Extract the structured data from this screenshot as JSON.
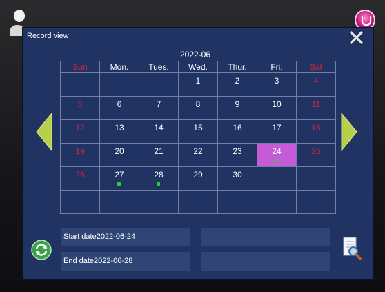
{
  "window": {
    "title": "Record view"
  },
  "calendar": {
    "month": "2022-06",
    "weekdays": [
      "Sun",
      "Mon.",
      "Tues.",
      "Wed.",
      "Thur.",
      "Fri.",
      "Sat"
    ],
    "weeks": [
      [
        "",
        "",
        "",
        "1",
        "2",
        "3",
        "4"
      ],
      [
        "5",
        "6",
        "7",
        "8",
        "9",
        "10",
        "11"
      ],
      [
        "12",
        "13",
        "14",
        "15",
        "16",
        "17",
        "18"
      ],
      [
        "19",
        "20",
        "21",
        "22",
        "23",
        "24",
        "25"
      ],
      [
        "26",
        "27",
        "28",
        "29",
        "30",
        "",
        ""
      ],
      [
        "",
        "",
        "",
        "",
        "",
        "",
        ""
      ]
    ],
    "selected_day": "24",
    "record_days": [
      "24",
      "27",
      "28"
    ],
    "colors": {
      "weekend": "#d9243a",
      "selected": "#c55bd6",
      "record_dot": "#2bd12b"
    }
  },
  "filters": {
    "start_date": "Start date2022-06-24",
    "end_date": "End date2022-06-28"
  },
  "icons": {
    "user": "user-icon",
    "top_right": "app-badge-icon",
    "close": "close-icon",
    "prev": "chevron-left-icon",
    "next": "chevron-right-icon",
    "refresh": "refresh-icon",
    "search_doc": "search-document-icon"
  }
}
